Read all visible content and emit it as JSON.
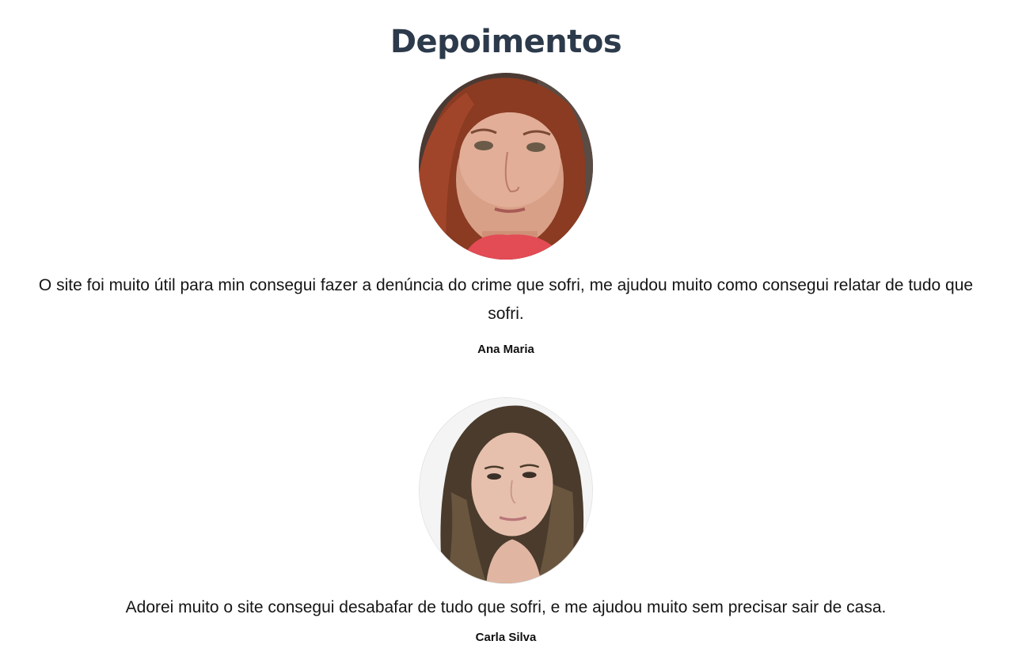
{
  "section": {
    "title": "Depoimentos"
  },
  "testimonials": [
    {
      "quote": "O site foi muito útil para min consegui fazer a denúncia do crime que sofri, me ajudou muito como consegui relatar de tudo que sofri.",
      "author": "Ana Maria"
    },
    {
      "quote": "Adorei muito o site consegui desabafar de tudo que sofri, e me ajudou muito sem precisar sair de casa.",
      "author": "Carla Silva"
    }
  ],
  "colors": {
    "title": "#2c3a4b",
    "text": "#151515",
    "background": "#ffffff"
  }
}
